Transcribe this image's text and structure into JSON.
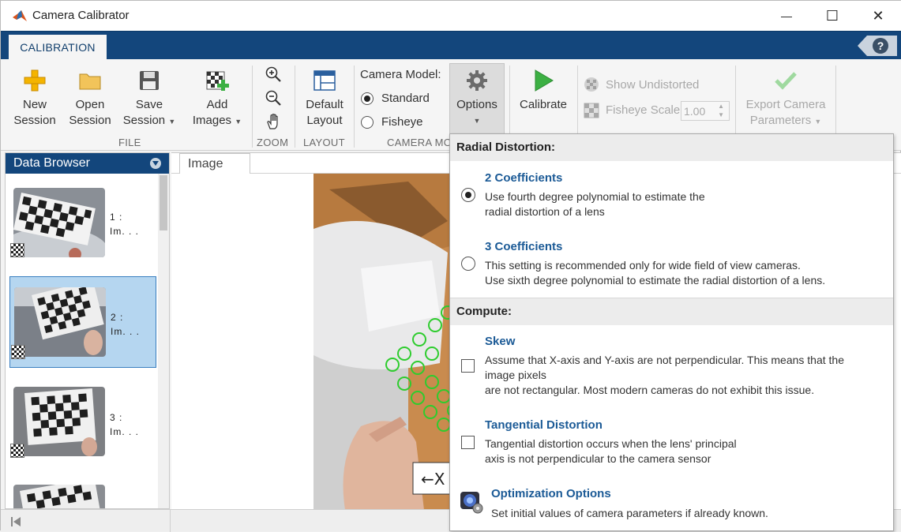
{
  "window": {
    "title": "Camera Calibrator",
    "minimize": "—",
    "maximize": "☐",
    "close": "✕"
  },
  "ribbon": {
    "tab_label": "CALIBRATION",
    "help": "?",
    "file": {
      "group_label": "FILE",
      "new_session": [
        "New",
        "Session"
      ],
      "open_session": [
        "Open",
        "Session"
      ],
      "save_session": [
        "Save",
        "Session"
      ],
      "add_images": [
        "Add",
        "Images"
      ]
    },
    "zoom_label": "ZOOM",
    "layout": {
      "group_label": "LAYOUT",
      "default_layout": [
        "Default",
        "Layout"
      ]
    },
    "camera_model": {
      "group_label": "CAMERA MO",
      "label": "Camera Model:",
      "standard": "Standard",
      "fisheye": "Fisheye",
      "selected": "Standard"
    },
    "options_label": "Options",
    "calibrate_label": "Calibrate",
    "show_undistorted": "Show Undistorted",
    "fisheye_scale_label": "Fisheye Scale",
    "fisheye_scale_value": "1.00",
    "export": [
      "Export Camera",
      "Parameters"
    ]
  },
  "data_browser": {
    "title": "Data Browser",
    "items": [
      {
        "label_num": "1 :",
        "label_name": "Im. . ."
      },
      {
        "label_num": "2 :",
        "label_name": "Im. . ."
      },
      {
        "label_num": "3 :",
        "label_name": "Im. . ."
      }
    ],
    "selected_index": 1
  },
  "image_panel": {
    "tab_label": "Image"
  },
  "options_popup": {
    "radial_heading": "Radial Distortion:",
    "coeff2_title": "2 Coefficients",
    "coeff2_desc": [
      "Use fourth degree polynomial to estimate the",
      "radial distortion of a lens"
    ],
    "coeff3_title": "3 Coefficients",
    "coeff3_desc": [
      "This setting is recommended only for wide field of view cameras.",
      "Use sixth degree polynomial to estimate the radial distortion of a lens."
    ],
    "radial_selected": "2 Coefficients",
    "compute_heading": "Compute:",
    "skew_title": "Skew",
    "skew_desc": [
      "Assume that X-axis and Y-axis are not perpendicular. This means that the",
      "image pixels",
      "are not rectangular. Most modern cameras do not exhibit this issue."
    ],
    "skew_checked": false,
    "tangential_title": "Tangential Distortion",
    "tangential_desc": [
      "Tangential distortion occurs when the lens' principal",
      "axis is not perpendicular to the camera sensor"
    ],
    "tangential_checked": false,
    "optimization_title": "Optimization Options",
    "optimization_desc": "Set initial values of camera parameters if already known."
  },
  "colors": {
    "ribbon_blue": "#13467c",
    "link_blue": "#1b5a96",
    "selection": "#b5d6f0",
    "calibrate_green": "#3cb043",
    "detected_points": "#2ecc2e"
  }
}
